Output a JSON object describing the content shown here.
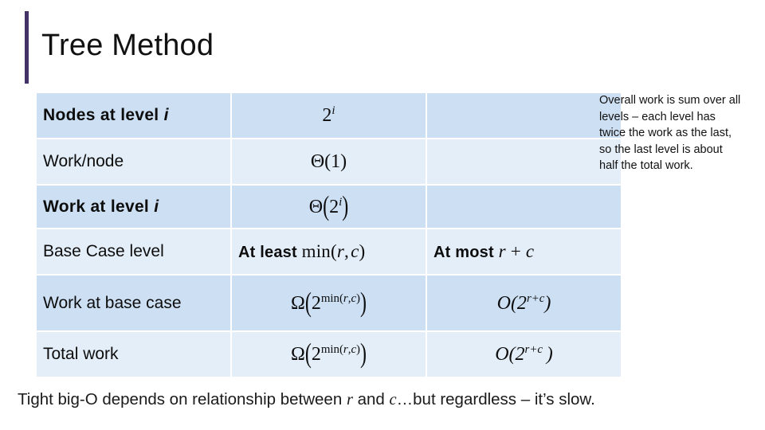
{
  "slide": {
    "title": "Tree Method",
    "accent_color": "#443266",
    "row_dark_color": "#ccdff3",
    "row_light_color": "#e4eef8"
  },
  "table": {
    "rows": [
      {
        "shade": "dark",
        "label": "Nodes at level i",
        "label_style": "bold",
        "middle": "2^i",
        "right": ""
      },
      {
        "shade": "light",
        "label": "Work/node",
        "label_style": "regular",
        "middle": "Θ(1)",
        "right": ""
      },
      {
        "shade": "dark",
        "label": "Work at level i",
        "label_style": "bold",
        "middle": "Θ(2^i)",
        "right": ""
      },
      {
        "shade": "light",
        "label": "Base Case level",
        "label_style": "regular",
        "middle": "At least min(r, c)",
        "right": "At most r + c"
      },
      {
        "shade": "dark",
        "label": "Work at base case",
        "label_style": "regular",
        "middle": "Ω(2^min(r,c))",
        "right": "O(2^(r+c))"
      },
      {
        "shade": "light",
        "label": "Total work",
        "label_style": "regular",
        "middle": "Ω(2^min(r,c))",
        "right": "O(2^(r+c))"
      }
    ]
  },
  "side_note": {
    "text": "Overall work is sum over all levels – each level has twice the work as the last, so the last level is about half the total work."
  },
  "caption": {
    "prefix": "Tight big-O depends on relationship between ",
    "var1": "r",
    "mid": " and ",
    "var2": "c",
    "suffix": "…but regardless – it’s slow."
  }
}
